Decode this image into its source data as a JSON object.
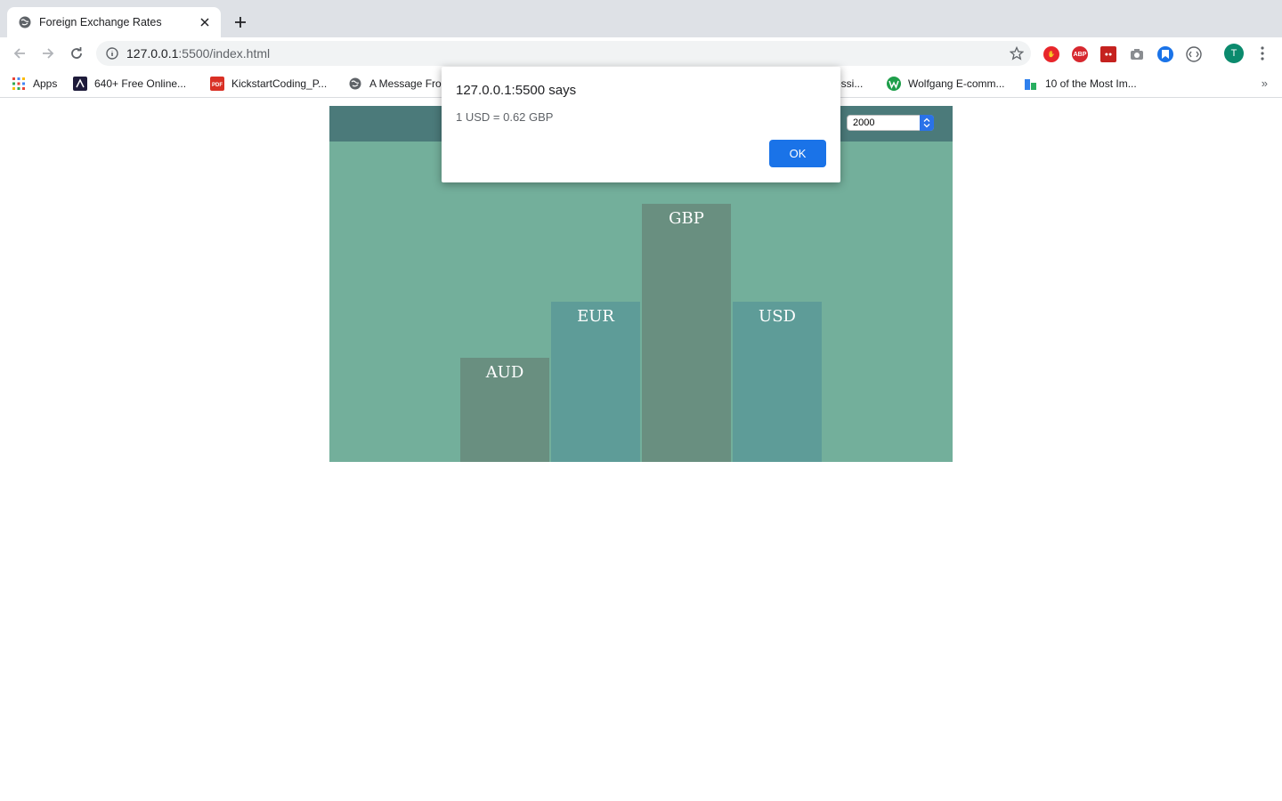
{
  "browser": {
    "tab": {
      "title": "Foreign Exchange Rates"
    },
    "url": {
      "host": "127.0.0.1",
      "rest": ":5500/index.html"
    },
    "profile_initial": "T",
    "bookmarks": [
      {
        "label": "Apps",
        "icon": "apps-grid-icon"
      },
      {
        "label": "640+ Free Online...",
        "icon": "bookmark-site-icon"
      },
      {
        "label": "KickstartCoding_P...",
        "icon": "pdf-icon"
      },
      {
        "label": "A Message Fro",
        "icon": "globe-icon"
      },
      {
        "label": "essi...",
        "icon": "bookmark-site-icon"
      },
      {
        "label": "Wolfgang E-comm...",
        "icon": "wolfgang-icon"
      },
      {
        "label": "10 of the Most Im...",
        "icon": "bookmark-site-icon"
      }
    ],
    "bookmarks_more": "»"
  },
  "app": {
    "year_select": {
      "value": "2000"
    },
    "colors": {
      "background": "#73af9b",
      "header": "#4b7a7a",
      "bar_dark": "#698f80",
      "bar_light": "#5e9c98"
    }
  },
  "chart_data": {
    "type": "bar",
    "categories": [
      "AUD",
      "EUR",
      "GBP",
      "USD"
    ],
    "values": [
      117,
      180,
      290,
      180
    ],
    "title": "",
    "xlabel": "",
    "ylabel": ""
  },
  "alert": {
    "title": "127.0.0.1:5500 says",
    "message": "1 USD = 0.62 GBP",
    "ok_label": "OK"
  }
}
